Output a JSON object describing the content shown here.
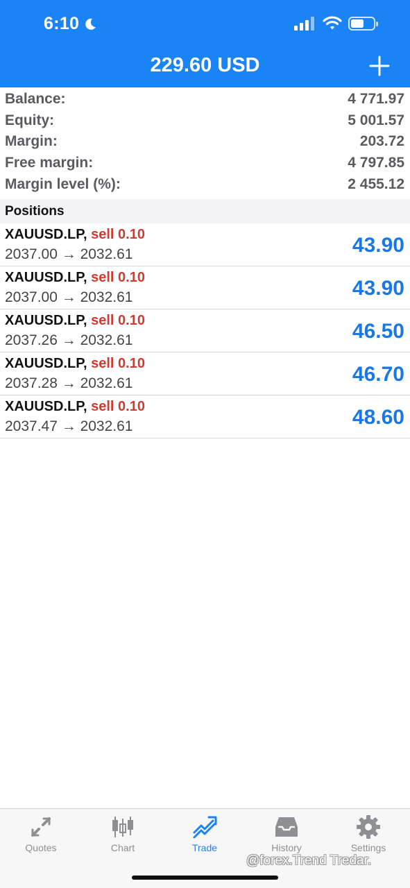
{
  "status_bar": {
    "time": "6:10"
  },
  "header": {
    "title": "229.60 USD"
  },
  "summary": [
    {
      "label": "Balance:",
      "value": "4 771.97"
    },
    {
      "label": "Equity:",
      "value": "5 001.57"
    },
    {
      "label": "Margin:",
      "value": "203.72"
    },
    {
      "label": "Free margin:",
      "value": "4 797.85"
    },
    {
      "label": "Margin level (%):",
      "value": "2 455.12"
    }
  ],
  "positions_title": "Positions",
  "positions": [
    {
      "symbol": "XAUUSD.LP",
      "type": "sell 0.10",
      "prices": "2037.00 → 2032.61",
      "profit": "43.90"
    },
    {
      "symbol": "XAUUSD.LP",
      "type": "sell 0.10",
      "prices": "2037.00 → 2032.61",
      "profit": "43.90"
    },
    {
      "symbol": "XAUUSD.LP",
      "type": "sell 0.10",
      "prices": "2037.26 → 2032.61",
      "profit": "46.50"
    },
    {
      "symbol": "XAUUSD.LP",
      "type": "sell 0.10",
      "prices": "2037.28 → 2032.61",
      "profit": "46.70"
    },
    {
      "symbol": "XAUUSD.LP",
      "type": "sell 0.10",
      "prices": "2037.47 → 2032.61",
      "profit": "48.60"
    }
  ],
  "tabs": [
    {
      "label": "Quotes",
      "icon": "quotes-icon"
    },
    {
      "label": "Chart",
      "icon": "chart-icon"
    },
    {
      "label": "Trade",
      "icon": "trade-icon",
      "active": true
    },
    {
      "label": "History",
      "icon": "history-icon"
    },
    {
      "label": "Settings",
      "icon": "gear-icon"
    }
  ],
  "watermark": "@forex.Trend Tredar.",
  "colors": {
    "accent": "#1a84f6",
    "sell": "#d33a2f",
    "profit": "#1a78e4",
    "tab_inactive": "#8e8e93"
  }
}
